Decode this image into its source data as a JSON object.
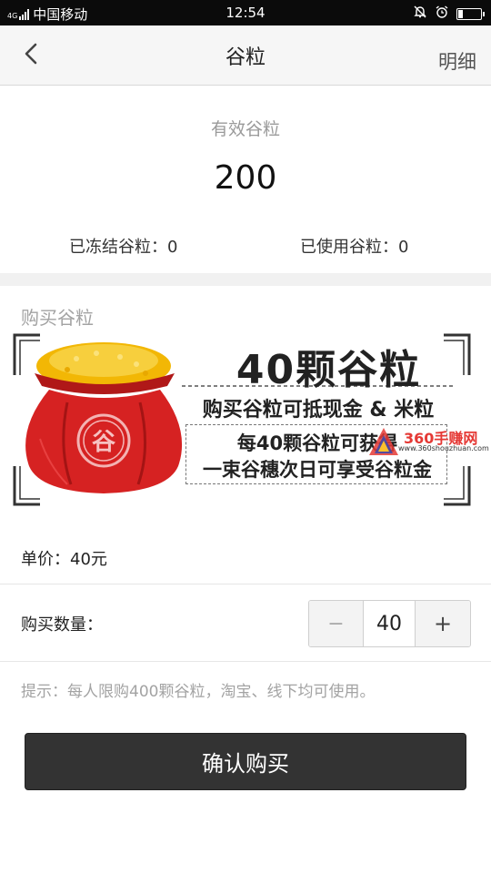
{
  "status_bar": {
    "network_label": "4G",
    "carrier": "中国移动",
    "time": "12:54",
    "battery_level": 0.2
  },
  "nav": {
    "title": "谷粒",
    "detail_label": "明细",
    "back_icon": "chevron-left-icon"
  },
  "balance": {
    "label": "有效谷粒",
    "value": "200",
    "frozen_text": "已冻结谷粒：0",
    "used_text": "已使用谷粒：0"
  },
  "purchase": {
    "section_title": "购买谷粒",
    "banner": {
      "headline": "40颗谷粒",
      "line2": "购买谷粒可抵现金 & 米粒",
      "line3": "每40颗谷粒可获得",
      "line4": "一束谷穗次日可享受谷粒金",
      "bag_character": "谷",
      "watermark_title": "360手赚网",
      "watermark_url": "www.360shouzhuan.com"
    },
    "unit_price_text": "单价：40元",
    "quantity_label": "购买数量：",
    "quantity_value": "40",
    "minus_symbol": "−",
    "plus_symbol": "+",
    "tip": "提示：每人限购400颗谷粒，淘宝、线下均可使用。",
    "confirm_label": "确认购买"
  },
  "colors": {
    "button_bg": "#333333",
    "bag_red": "#d62222",
    "grain_gold": "#f2b705",
    "watermark_red": "#e53935"
  }
}
